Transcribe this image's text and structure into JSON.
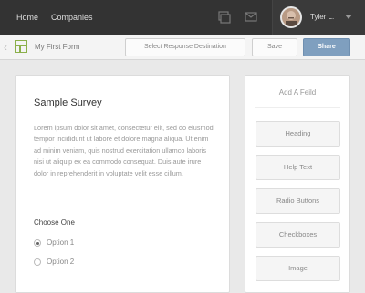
{
  "nav": {
    "links": [
      "Home",
      "Companies"
    ],
    "user_name": "Tyler L."
  },
  "toolbar": {
    "form_name": "My First Form",
    "select_destination_label": "Select Response Destination",
    "save_label": "Save",
    "share_label": "Share"
  },
  "survey": {
    "title": "Sample Survey",
    "body": "Lorem ipsum dolor sit amet, consectetur elit, sed do eiusmod tempor incididunt ut labore et dolore magna aliqua. Ut enim ad minim veniam, quis nostrud exercitation ullamco laboris nisi ut aliquip ex ea commodo consequat. Duis aute irure dolor in reprehenderit in voluptate velit esse cillum.",
    "question": "Choose One",
    "options": [
      "Option 1",
      "Option 2"
    ],
    "selected_option": "Option 1"
  },
  "panel": {
    "title": "Add A Feild",
    "items": [
      "Heading",
      "Help Text",
      "Radio Buttons",
      "Checkboxes",
      "Image"
    ]
  },
  "colors": {
    "topbar": "#333333",
    "share_button": "#7f9fbf",
    "form_icon": "#8bb04a"
  },
  "icons": [
    "inbox-icon",
    "mail-icon",
    "caret-down-icon",
    "back-chevron-icon",
    "form-icon",
    "radio-icon"
  ]
}
